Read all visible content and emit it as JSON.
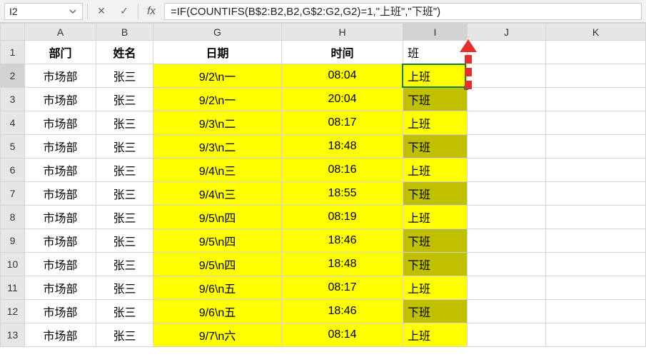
{
  "cell_ref": "I2",
  "formula": "=IF(COUNTIFS(B$2:B2,B2,G$2:G2,G2)=1,\"上班\",\"下班\")",
  "icons": {
    "cancel": "✕",
    "confirm": "✓",
    "fx": "fx",
    "dropdown": "▾"
  },
  "col_headers": [
    "A",
    "B",
    "G",
    "H",
    "I",
    "J",
    "K"
  ],
  "header_row": {
    "A": "部门",
    "B": "姓名",
    "G": "日期",
    "H": "时间",
    "I": "班"
  },
  "rows": [
    {
      "n": 2,
      "A": "市场部",
      "B": "张三",
      "G": "9/2\\n一",
      "H": "08:04",
      "I": "上班",
      "cls": "work"
    },
    {
      "n": 3,
      "A": "市场部",
      "B": "张三",
      "G": "9/2\\n一",
      "H": "20:04",
      "I": "下班",
      "cls": "off"
    },
    {
      "n": 4,
      "A": "市场部",
      "B": "张三",
      "G": "9/3\\n二",
      "H": "08:17",
      "I": "上班",
      "cls": "work"
    },
    {
      "n": 5,
      "A": "市场部",
      "B": "张三",
      "G": "9/3\\n二",
      "H": "18:48",
      "I": "下班",
      "cls": "off"
    },
    {
      "n": 6,
      "A": "市场部",
      "B": "张三",
      "G": "9/4\\n三",
      "H": "08:16",
      "I": "上班",
      "cls": "work"
    },
    {
      "n": 7,
      "A": "市场部",
      "B": "张三",
      "G": "9/4\\n三",
      "H": "18:55",
      "I": "下班",
      "cls": "off"
    },
    {
      "n": 8,
      "A": "市场部",
      "B": "张三",
      "G": "9/5\\n四",
      "H": "08:19",
      "I": "上班",
      "cls": "work"
    },
    {
      "n": 9,
      "A": "市场部",
      "B": "张三",
      "G": "9/5\\n四",
      "H": "18:46",
      "I": "下班",
      "cls": "off"
    },
    {
      "n": 10,
      "A": "市场部",
      "B": "张三",
      "G": "9/5\\n四",
      "H": "18:48",
      "I": "下班",
      "cls": "off"
    },
    {
      "n": 11,
      "A": "市场部",
      "B": "张三",
      "G": "9/6\\n五",
      "H": "08:17",
      "I": "上班",
      "cls": "work"
    },
    {
      "n": 12,
      "A": "市场部",
      "B": "张三",
      "G": "9/6\\n五",
      "H": "18:46",
      "I": "下班",
      "cls": "off"
    },
    {
      "n": 13,
      "A": "市场部",
      "B": "张三",
      "G": "9/7\\n六",
      "H": "08:14",
      "I": "上班",
      "cls": "work"
    }
  ]
}
